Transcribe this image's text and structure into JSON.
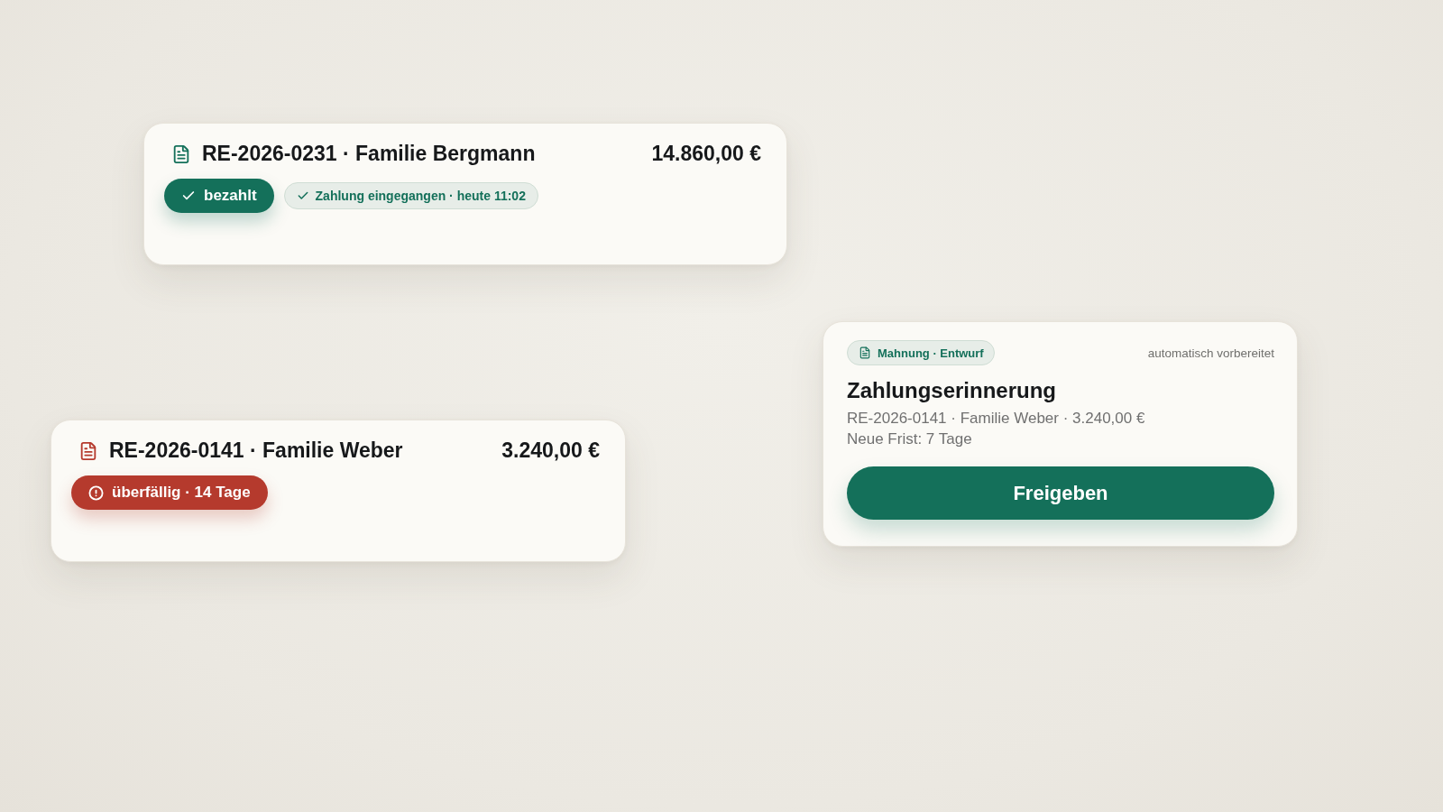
{
  "invoices": [
    {
      "kind": "paid",
      "title": "RE-2026-0231 · Familie Bergmann",
      "amount": "14.860,00 €",
      "status": "bezahlt",
      "note": "Zahlung eingegangen · heute 11:02"
    },
    {
      "kind": "overdue",
      "title": "RE-2026-0141 · Familie Weber",
      "amount": "3.240,00 €",
      "status": "überfällig · 14 Tage"
    }
  ],
  "reminder": {
    "tag": "Mahnung · Entwurf",
    "source": "automatisch vorbereitet",
    "title": "Zahlungserinnerung",
    "details": [
      "RE-2026-0141 · Familie Weber · 3.240,00 €",
      "Neue Frist: 7 Tage"
    ],
    "button": "Freigeben"
  }
}
